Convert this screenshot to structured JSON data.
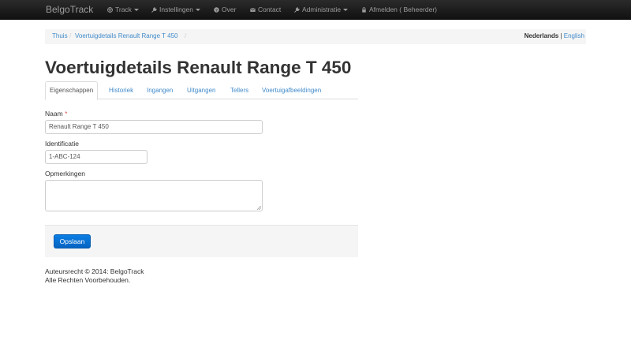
{
  "navbar": {
    "brand": "BelgoTrack",
    "items": [
      {
        "label": "Track",
        "icon": "globe-icon",
        "dropdown": true
      },
      {
        "label": "Instellingen",
        "icon": "wrench-icon",
        "dropdown": true
      },
      {
        "label": "Over",
        "icon": "info-icon",
        "dropdown": false
      },
      {
        "label": "Contact",
        "icon": "envelope-icon",
        "dropdown": false
      },
      {
        "label": "Administratie",
        "icon": "wrench-icon",
        "dropdown": true
      },
      {
        "label": "Afmelden ( Beheerder)",
        "icon": "lock-icon",
        "dropdown": false
      }
    ]
  },
  "breadcrumb": {
    "home": "Thuis",
    "current": "Voertuigdetails Renault Range T 450",
    "separator": "/"
  },
  "language": {
    "current": "Nederlands",
    "separator": "|",
    "other": "English"
  },
  "page": {
    "title": "Voertuigdetails Renault Range T 450"
  },
  "tabs": [
    "Eigenschappen",
    "Historiek",
    "Ingangen",
    "Uitgangen",
    "Tellers",
    "Voertuigafbeeldingen"
  ],
  "form": {
    "name_label": "Naam",
    "required_marker": "*",
    "name_value": "Renault Range T 450",
    "id_label": "Identificatie",
    "id_value": "1-ABC-124",
    "remarks_label": "Opmerkingen",
    "remarks_value": "",
    "save_label": "Opslaan"
  },
  "footer": {
    "line1": "Auteursrecht © 2014: BelgoTrack",
    "line2": "Alle Rechten Voorbehouden."
  },
  "colors": {
    "link": "#428bca",
    "primary": "#0a7ee5",
    "navbar": "#1b1b1b",
    "required": "#d9534f"
  }
}
